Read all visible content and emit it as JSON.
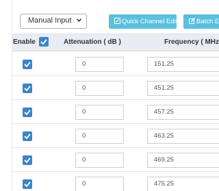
{
  "toolbar": {
    "mode_select": {
      "selected": "Manual Input"
    },
    "quick_channel_edit_label": "Quick Channel Edit",
    "batch_edit_label": "Batch Ed"
  },
  "table": {
    "columns": {
      "enable": "Enable",
      "attenuation": "Attenuation ( dB )",
      "frequency": "Frequency ( MHz )"
    },
    "select_all_checked": true,
    "rows": [
      {
        "enabled": true,
        "attenuation": "0",
        "frequency": "151.25"
      },
      {
        "enabled": true,
        "attenuation": "0",
        "frequency": "451.25"
      },
      {
        "enabled": true,
        "attenuation": "0",
        "frequency": "457.25"
      },
      {
        "enabled": true,
        "attenuation": "0",
        "frequency": "463.25"
      },
      {
        "enabled": true,
        "attenuation": "0",
        "frequency": "469.25"
      },
      {
        "enabled": true,
        "attenuation": "0",
        "frequency": "475.25"
      }
    ]
  },
  "colors": {
    "button_bg": "#5bc0de",
    "checkbox_bg": "#3a86c8",
    "header_bg": "#e9edf3"
  }
}
